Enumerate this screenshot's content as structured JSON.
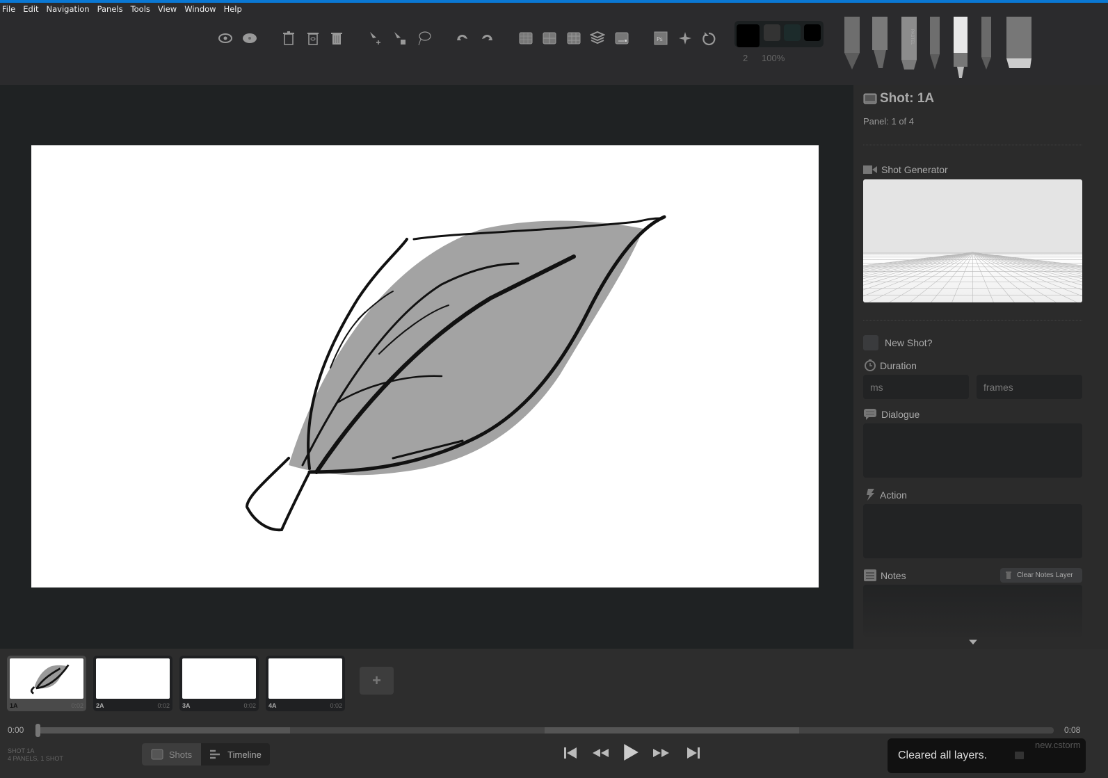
{
  "menu": [
    "File",
    "Edit",
    "Navigation",
    "Panels",
    "Tools",
    "View",
    "Window",
    "Help"
  ],
  "toolbar": {
    "brush_size": "2",
    "brush_opacity": "100%",
    "colors": [
      "#000000",
      "#333333",
      "#1c2b2b",
      "#000000"
    ],
    "pencils": [
      "light-pencil",
      "brush-pen",
      "pastel",
      "pencil",
      "marker",
      "fine-pen",
      "eraser"
    ],
    "marker_brand": "mcrkie",
    "pastel_label": "PASTEL"
  },
  "panel": {
    "shot_title": "Shot: 1A",
    "panel_info": "Panel: 1 of 4",
    "shot_generator_label": "Shot Generator",
    "new_shot_label": "New Shot?",
    "new_shot_checked": false,
    "duration_label": "Duration",
    "ms_placeholder": "ms",
    "frames_placeholder": "frames",
    "dialogue_label": "Dialogue",
    "action_label": "Action",
    "notes_label": "Notes",
    "clear_notes_label": "Clear Notes Layer"
  },
  "board_thumbnails": [
    {
      "label": "1A",
      "duration": "0:02",
      "selected": true
    },
    {
      "label": "2A",
      "duration": "0:02",
      "selected": false
    },
    {
      "label": "3A",
      "duration": "0:02",
      "selected": false
    },
    {
      "label": "4A",
      "duration": "0:02",
      "selected": false
    }
  ],
  "add_board_label": "+",
  "timeline": {
    "start": "0:00",
    "end": "0:08",
    "position": 0
  },
  "status": {
    "shot": "SHOT 1A",
    "summary": "4 PANELS, 1 SHOT"
  },
  "view_tabs": {
    "shots": "Shots",
    "timeline": "Timeline",
    "active": "shots"
  },
  "toast": "Cleared all layers.",
  "filename": "new.cstorm"
}
